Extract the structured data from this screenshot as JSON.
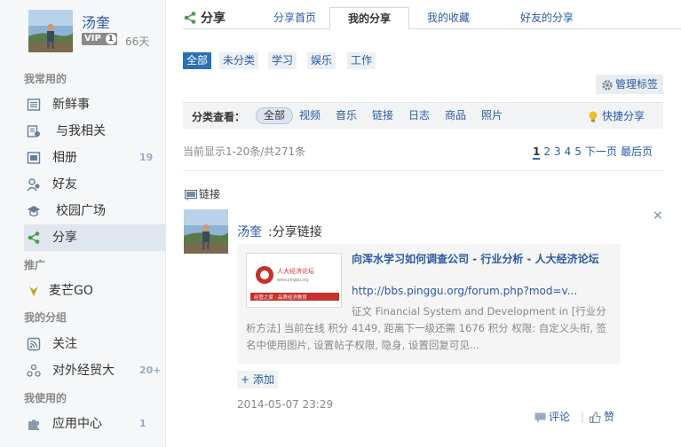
{
  "user": {
    "name": "汤奎",
    "vip": "VIP",
    "vip_level": "1",
    "days": "66天"
  },
  "sidebar": {
    "sections": [
      "我常用的",
      "推广",
      "我的分组",
      "我使用的"
    ],
    "items": [
      {
        "label": "新鲜事",
        "count": "",
        "icon": "news-icon"
      },
      {
        "label": "与我相关",
        "count": "",
        "icon": "related-icon"
      },
      {
        "label": "相册",
        "count": "19",
        "icon": "album-icon"
      },
      {
        "label": "好友",
        "count": "",
        "icon": "friends-icon"
      },
      {
        "label": "校园广场",
        "count": "",
        "icon": "campus-icon"
      },
      {
        "label": "分享",
        "count": "",
        "icon": "share-icon"
      },
      {
        "label": "麦芒GO",
        "count": "",
        "icon": "maimang-icon"
      },
      {
        "label": "关注",
        "count": "",
        "icon": "rss-icon"
      },
      {
        "label": "对外经贸大",
        "count": "20+",
        "icon": "group-icon"
      },
      {
        "label": "应用中心",
        "count": "1",
        "icon": "puzzle-icon"
      }
    ]
  },
  "header": {
    "title": "分享",
    "tabs": [
      "分享首页",
      "我的分享",
      "我的收藏",
      "好友的分享"
    ],
    "active_tab": "我的分享"
  },
  "categories": {
    "items": [
      "全部",
      "未分类",
      "学习",
      "娱乐",
      "工作"
    ],
    "active": "全部"
  },
  "manage_tags": "管理标签",
  "filter": {
    "label": "分类查看：",
    "items": [
      "全部",
      "视频",
      "音乐",
      "链接",
      "日志",
      "商品",
      "照片"
    ],
    "active": "全部",
    "quick_share": "快捷分享"
  },
  "status_text": "当前显示1-20条/共271条",
  "pager": {
    "pages": [
      "1",
      "2",
      "3",
      "4",
      "5"
    ],
    "current": "1",
    "next": "下一页",
    "last": "最后页"
  },
  "post": {
    "type_label": "链接",
    "author": "汤奎",
    "action": ":分享链接",
    "card": {
      "title": "向浑水学习如何调查公司 - 行业分析 - 人大经济论坛",
      "url": "http://bbs.pinggu.org/forum.php?mod=v...",
      "description": "征文 Financial System and Development in [行业分析方法] 当前在线 积分 4149, 距离下一级还需 1676 积分 权限: 自定义头衔, 签名中使用图片, 设置帖子权限, 隐身, 设置回复可见...",
      "thumb_text": "人大经济论坛",
      "thumb_sub": "www.pinggu.org",
      "thumb_slogan": "经管之家 · 品质经济教育"
    },
    "add_label": "+ 添加",
    "time": "2014-05-07 23:29",
    "comment": "评论",
    "like": "赞"
  },
  "colors": {
    "link": "#2b5aa3",
    "accent": "#2b6fb6",
    "sidebar_bg": "#f5f7f9"
  }
}
